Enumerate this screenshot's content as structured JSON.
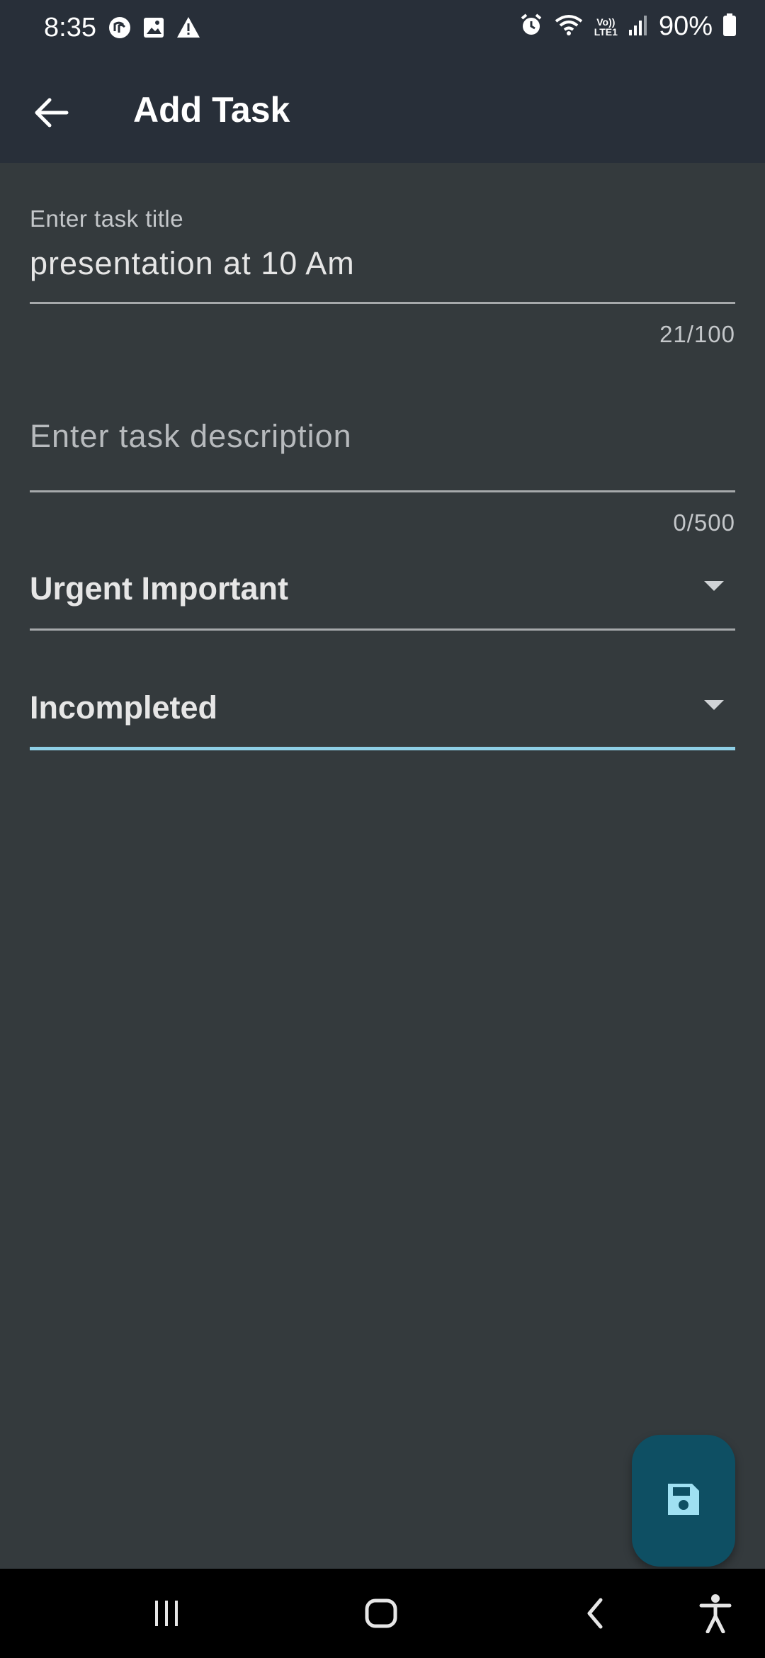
{
  "status_bar": {
    "time": "8:35",
    "battery": "90%",
    "volte_top": "Vo))",
    "volte_bottom": "LTE1"
  },
  "app_bar": {
    "title": "Add Task"
  },
  "form": {
    "title_field": {
      "label": "Enter task title",
      "value": "presentation at 10 Am",
      "counter": "21/100"
    },
    "description_field": {
      "placeholder": "Enter task description",
      "counter": "0/500"
    },
    "priority_dropdown": {
      "selected": "Urgent Important"
    },
    "status_dropdown": {
      "selected": "Incompleted"
    }
  },
  "colors": {
    "background": "#343a3d",
    "app_bar": "#282f39",
    "accent": "#8ecfe6",
    "fab": "#0e4f63"
  },
  "icons": {
    "back": "arrow-left-icon",
    "save": "floppy-disk-icon"
  }
}
